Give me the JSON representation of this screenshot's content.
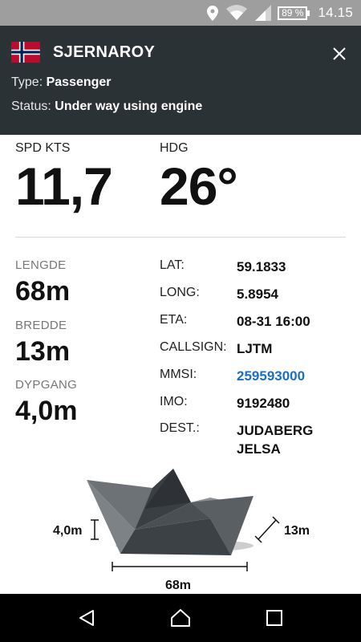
{
  "status_bar": {
    "battery": "89 %",
    "time": "14.15"
  },
  "vessel": {
    "name": "SJERNAROY",
    "type_label": "Type:",
    "type_value": "Passenger",
    "status_label": "Status:",
    "status_value": "Under way using engine"
  },
  "stats": {
    "speed_label": "SPD KTS",
    "speed_value": "11,7",
    "heading_label": "HDG",
    "heading_value": "26°"
  },
  "dimensions": {
    "length_label": "LENGDE",
    "length_value": "68m",
    "width_label": "BREDDE",
    "width_value": "13m",
    "draught_label": "DYPGANG",
    "draught_value": "4,0m"
  },
  "details": {
    "lat_label": "LAT:",
    "lat_value": "59.1833",
    "long_label": "LONG:",
    "long_value": "5.8954",
    "eta_label": "ETA:",
    "eta_value": "08-31 16:00",
    "callsign_label": "CALLSIGN:",
    "callsign_value": "LJTM",
    "mmsi_label": "MMSI:",
    "mmsi_value": "259593000",
    "imo_label": "IMO:",
    "imo_value": "9192480",
    "dest_label": "DEST.:",
    "dest_value_line1": "JUDABERG",
    "dest_value_line2": "JELSA"
  },
  "illustration": {
    "draught_label": "4,0m",
    "width_label": "13m",
    "length_label": "68m"
  },
  "colors": {
    "header_bg": "#2b3235",
    "status_bar_bg": "#9e9e9e",
    "link": "#1a6fc4"
  },
  "icons": {
    "location": "location-pin-icon",
    "wifi": "wifi-icon",
    "signal": "cell-signal-icon",
    "battery": "battery-icon",
    "close": "close-icon",
    "back": "back-icon",
    "home": "home-icon",
    "recents": "recents-icon"
  }
}
